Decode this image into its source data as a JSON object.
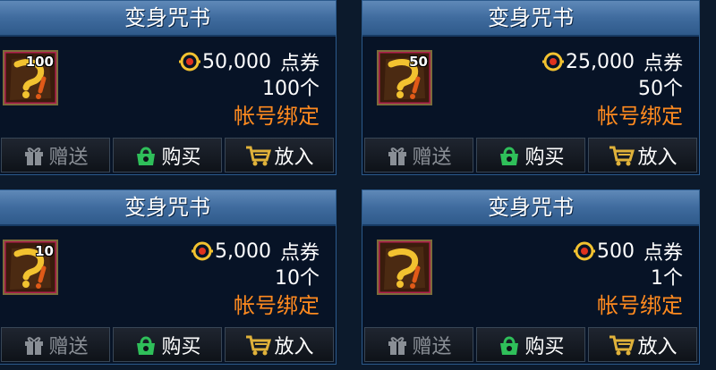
{
  "colors": {
    "bind_text": "#ff8a1f",
    "title_bar": "#4a75a6",
    "card_bg": "#071326",
    "gift_disabled": "#8a8f96",
    "buy_icon": "#2fbf5a",
    "cart_icon": "#e0b23a"
  },
  "cards": [
    {
      "title": "变身咒书",
      "badge": "100",
      "price": "50,000",
      "price_unit": "点券",
      "count": "100个",
      "bind": "帐号绑定",
      "buttons": {
        "gift": "赠送",
        "buy": "购买",
        "cart": "放入"
      }
    },
    {
      "title": "变身咒书",
      "badge": "50",
      "price": "25,000",
      "price_unit": "点券",
      "count": "50个",
      "bind": "帐号绑定",
      "buttons": {
        "gift": "赠送",
        "buy": "购买",
        "cart": "放入"
      }
    },
    {
      "title": "变身咒书",
      "badge": "10",
      "price": "5,000",
      "price_unit": "点券",
      "count": "10个",
      "bind": "帐号绑定",
      "buttons": {
        "gift": "赠送",
        "buy": "购买",
        "cart": "放入"
      }
    },
    {
      "title": "变身咒书",
      "badge": "",
      "price": "500",
      "price_unit": "点券",
      "count": "1个",
      "bind": "帐号绑定",
      "buttons": {
        "gift": "赠送",
        "buy": "购买",
        "cart": "放入"
      }
    }
  ]
}
